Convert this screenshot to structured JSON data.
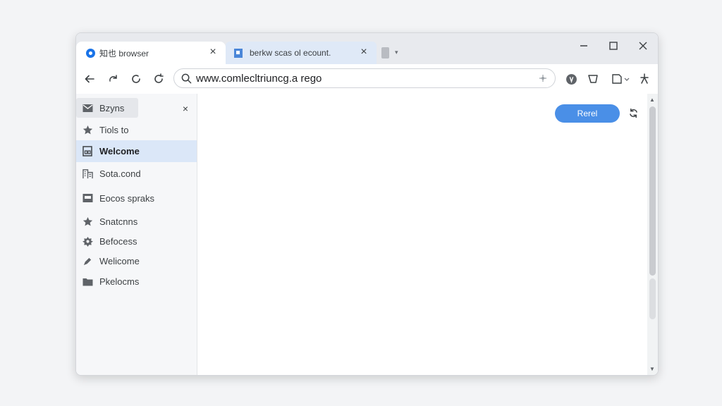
{
  "tabs": [
    {
      "title": "知也 browser",
      "close": "×",
      "icon": "browser-logo-icon"
    },
    {
      "title": "berkw scas ol ecount.",
      "close": "×",
      "icon": "flag-icon"
    }
  ],
  "tab_dropdown": "▾",
  "window_controls": {
    "minimize": "minimize-icon",
    "maximize": "maximize-icon",
    "close": "close-icon"
  },
  "address_bar": {
    "url": "www.comlecltriuncg.a rego"
  },
  "toolbar_icons": [
    "back-icon",
    "forward-icon",
    "reload-icon",
    "refresh-icon",
    "extension-icon",
    "shield-icon",
    "page-icon",
    "menu-icon"
  ],
  "sidebar": {
    "close": "×",
    "items": [
      {
        "label": "Bzyns",
        "icon": "mail-icon"
      },
      {
        "label": "Tiols to",
        "icon": "star-icon"
      },
      {
        "label": "Welcome",
        "icon": "document-icon",
        "active": true
      },
      {
        "label": "Sota.cond",
        "icon": "building-icon"
      },
      {
        "label": "Eocos spraks",
        "icon": "image-icon"
      },
      {
        "label": "Snatcnns",
        "icon": "star-icon"
      },
      {
        "label": "Befocess",
        "icon": "gear-icon"
      },
      {
        "label": "Welicome",
        "icon": "pen-icon"
      },
      {
        "label": "Pkelocms",
        "icon": "folder-icon"
      }
    ]
  },
  "content": {
    "button_label": "Rerel",
    "side_icon": "sync-icon"
  },
  "colors": {
    "accent": "#4a8fe7",
    "active_row": "#dbe7f8",
    "tab_active_bg": "#dfe9f7"
  }
}
